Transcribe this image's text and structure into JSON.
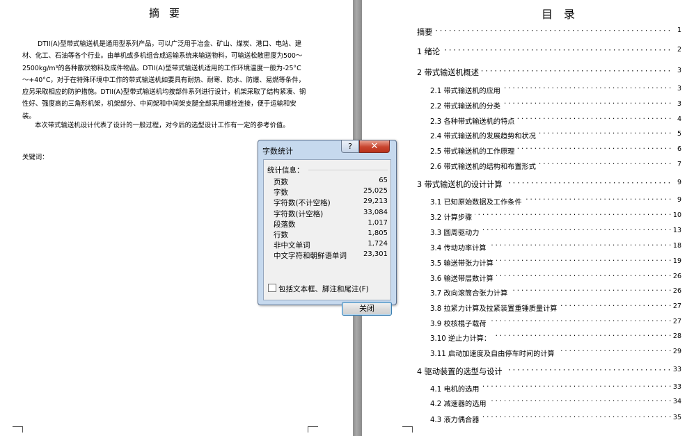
{
  "abstract": {
    "title": "摘要",
    "paragraph1": "DTII(A)型带式输送机是通用型系列产品，可以广泛用于冶金、矿山、煤炭、港口、电站、建材、化工、石油等各个行业。由单机或多机组合成运输系统来输送物料，可输送松散密度为500～2500kg/m³的各种散状物料及成件物品。DTII(A)型带式输送机适用的工作环境温度一般为-25°C～+40°C，对于在特殊环境中工作的带式输送机如要具有耐热、耐寒、防水、防爆、易燃等条件，应另采取相应的防护措施。DTII(A)型带式输送机均按部件系列进行设计，机架采取了结构紧凑、钢性好、强度高的三角形机架，机架部分、中间架和中间架支腿全部采用螺栓连接，便于运输和安装。",
    "paragraph2": "本次带式输送机设计代表了设计的一般过程，对今后的选型设计工作有一定的参考价值。",
    "keywords_label": "关键词："
  },
  "toc": {
    "title": "目录",
    "entries": [
      {
        "label": "摘要",
        "page": "1",
        "level": 1
      },
      {
        "label": "1 绪论",
        "page": "2",
        "level": 1
      },
      {
        "label": "2 带式输送机概述",
        "page": "3",
        "level": 1
      },
      {
        "label": "2.1 带式输送机的应用",
        "page": "3",
        "level": 2
      },
      {
        "label": "2.2 带式输送机的分类",
        "page": "3",
        "level": 2
      },
      {
        "label": "2.3 各种带式输送机的特点",
        "page": "4",
        "level": 2
      },
      {
        "label": "2.4 带式输送机的发展趋势和状况",
        "page": "5",
        "level": 2
      },
      {
        "label": "2.5 带式输送机的工作原理",
        "page": "6",
        "level": 2
      },
      {
        "label": "2.6 带式输送机的结构和布置形式",
        "page": "7",
        "level": 2
      },
      {
        "label": "3 带式输送机的设计计算",
        "page": "9",
        "level": 1
      },
      {
        "label": "3.1 已知原始数据及工作条件",
        "page": "9",
        "level": 2
      },
      {
        "label": "3.2 计算步骤",
        "page": "10",
        "level": 2
      },
      {
        "label": "3.3 圆周驱动力",
        "page": "13",
        "level": 2
      },
      {
        "label": "3.4 传动功率计算",
        "page": "18",
        "level": 2
      },
      {
        "label": "3.5 输送带张力计算",
        "page": "19",
        "level": 2
      },
      {
        "label": "3.6 输送带层数计算",
        "page": "26",
        "level": 2
      },
      {
        "label": "3.7 改向滚筒合张力计算",
        "page": "26",
        "level": 2
      },
      {
        "label": "3.8 拉紧力计算及拉紧装置重锤质量计算",
        "page": "27",
        "level": 2
      },
      {
        "label": "3.9 校核棍子载荷",
        "page": "27",
        "level": 2
      },
      {
        "label": "3.10 逆止力计算：",
        "page": "28",
        "level": 2
      },
      {
        "label": "3.11 启动加速度及自由停车时间的计算",
        "page": "29",
        "level": 2
      },
      {
        "label": "4 驱动装置的选型与设计",
        "page": "33",
        "level": 1
      },
      {
        "label": "4.1 电机的选用",
        "page": "33",
        "level": 2
      },
      {
        "label": "4.2 减速器的选用",
        "page": "34",
        "level": 2
      },
      {
        "label": "4.3 液力偶合器",
        "page": "35",
        "level": 2
      }
    ]
  },
  "dialog": {
    "title": "字数统计",
    "help_label": "?",
    "close_icon_label": "✕",
    "stats_header": "统计信息：",
    "stats": [
      {
        "label": "页数",
        "value": "65"
      },
      {
        "label": "字数",
        "value": "25,025"
      },
      {
        "label": "字符数(不计空格)",
        "value": "29,213"
      },
      {
        "label": "字符数(计空格)",
        "value": "33,084"
      },
      {
        "label": "段落数",
        "value": "1,017"
      },
      {
        "label": "行数",
        "value": "1,805"
      },
      {
        "label": "非中文单词",
        "value": "1,724"
      },
      {
        "label": "中文字符和朝鲜语单词",
        "value": "23,301"
      }
    ],
    "checkbox_label": "包括文本框、脚注和尾注(F)",
    "checkbox_checked": false,
    "close_button_label": "关闭"
  }
}
